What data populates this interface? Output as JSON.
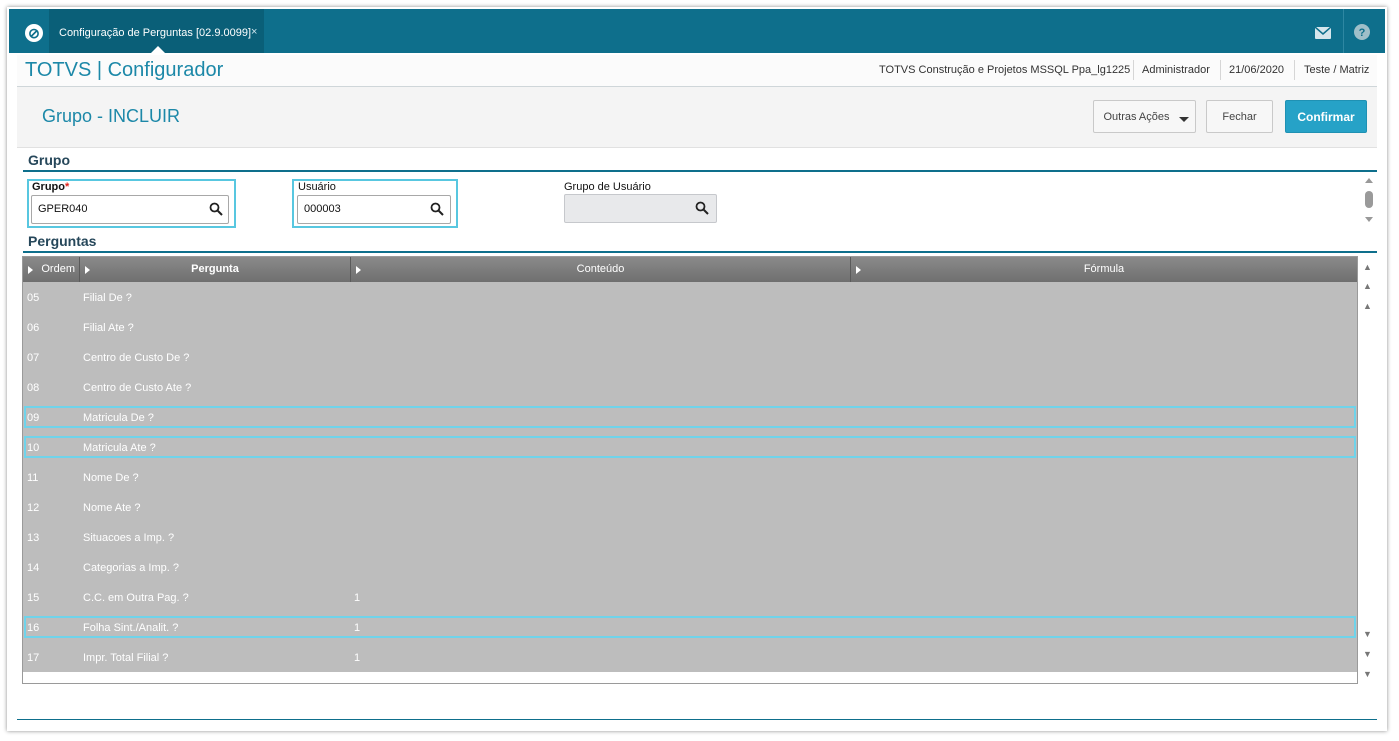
{
  "tab": {
    "title": "Configuração de Perguntas [02.9.0099]",
    "close": "×"
  },
  "topbar": {
    "mail_icon": "mail-icon",
    "help_icon": "help-icon",
    "logo": "totvs-logo"
  },
  "header": {
    "brand": "TOTVS | Configurador",
    "company": "TOTVS Construção e Projetos MSSQL Ppa_lg1225",
    "user": "Administrador",
    "date": "21/06/2020",
    "branch": "Teste / Matriz"
  },
  "page": {
    "title": "Grupo - INCLUIR",
    "buttons": {
      "more": "Outras Ações",
      "close": "Fechar",
      "confirm": "Confirmar"
    }
  },
  "section_grupo": {
    "title": "Grupo",
    "grupo_label": "Grupo",
    "grupo_required": "*",
    "grupo_value": "GPER040",
    "usuario_label": "Usuário",
    "usuario_value": "000003",
    "grupo_usuario_label": "Grupo de Usuário",
    "grupo_usuario_value": ""
  },
  "section_perguntas": {
    "title": "Perguntas",
    "columns": [
      "Ordem",
      "Pergunta",
      "Conteúdo",
      "Fórmula"
    ],
    "rows": [
      {
        "ordem": "05",
        "pergunta": "Filial De ?",
        "conteudo": "",
        "formula": "",
        "selected": false
      },
      {
        "ordem": "06",
        "pergunta": "Filial Ate ?",
        "conteudo": "",
        "formula": "",
        "selected": false
      },
      {
        "ordem": "07",
        "pergunta": "Centro de Custo De ?",
        "conteudo": "",
        "formula": "",
        "selected": false
      },
      {
        "ordem": "08",
        "pergunta": "Centro de Custo Ate ?",
        "conteudo": "",
        "formula": "",
        "selected": false
      },
      {
        "ordem": "09",
        "pergunta": "Matricula De ?",
        "conteudo": "",
        "formula": "",
        "selected": true
      },
      {
        "ordem": "10",
        "pergunta": "Matricula Ate ?",
        "conteudo": "",
        "formula": "",
        "selected": true
      },
      {
        "ordem": "11",
        "pergunta": "Nome De ?",
        "conteudo": "",
        "formula": "",
        "selected": false
      },
      {
        "ordem": "12",
        "pergunta": "Nome Ate ?",
        "conteudo": "",
        "formula": "",
        "selected": false
      },
      {
        "ordem": "13",
        "pergunta": "Situacoes a Imp. ?",
        "conteudo": "",
        "formula": "",
        "selected": false
      },
      {
        "ordem": "14",
        "pergunta": "Categorias a Imp. ?",
        "conteudo": "",
        "formula": "",
        "selected": false
      },
      {
        "ordem": "15",
        "pergunta": "C.C. em Outra Pag. ?",
        "conteudo": "1",
        "formula": "",
        "selected": false
      },
      {
        "ordem": "16",
        "pergunta": "Folha Sint./Analit. ?",
        "conteudo": "1",
        "formula": "",
        "selected": true
      },
      {
        "ordem": "17",
        "pergunta": "Impr. Total Filial ?",
        "conteudo": "1",
        "formula": "",
        "selected": false
      }
    ]
  },
  "colors": {
    "accent": "#0e6f8c",
    "brand_text": "#1c88a8",
    "highlight": "#58c7e0",
    "row_bg": "#bdbdbd",
    "required": "#e0241b"
  }
}
